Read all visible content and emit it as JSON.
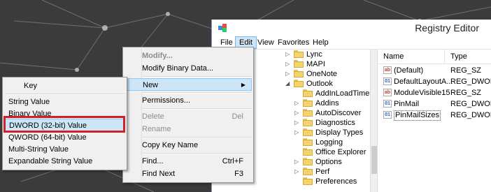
{
  "window": {
    "title": "Registry Editor",
    "menu": [
      "File",
      "Edit",
      "View",
      "Favorites",
      "Help"
    ],
    "active_menu": "Edit"
  },
  "tree": {
    "items": [
      {
        "label": "Lync",
        "expander": "▷"
      },
      {
        "label": "MAPI",
        "expander": "▷"
      },
      {
        "label": "OneNote",
        "expander": "▷"
      },
      {
        "label": "Outlook",
        "expander": "◢"
      },
      {
        "label": "AddInLoadTimes",
        "expander": ""
      },
      {
        "label": "Addins",
        "expander": "▷"
      },
      {
        "label": "AutoDiscover",
        "expander": "▷"
      },
      {
        "label": "Diagnostics",
        "expander": "▷"
      },
      {
        "label": "Display Types",
        "expander": "▷"
      },
      {
        "label": "Logging",
        "expander": ""
      },
      {
        "label": "Office Explorer",
        "expander": ""
      },
      {
        "label": "Options",
        "expander": "▷"
      },
      {
        "label": "Perf",
        "expander": "▷"
      },
      {
        "label": "Preferences",
        "expander": ""
      }
    ]
  },
  "values": {
    "columns": {
      "name": "Name",
      "type": "Type"
    },
    "rows": [
      {
        "icon": "ab",
        "name": "(Default)",
        "type": "REG_SZ"
      },
      {
        "icon": "bin",
        "name": "DefaultLayoutA...",
        "type": "REG_DWORD"
      },
      {
        "icon": "ab",
        "name": "ModuleVisible15",
        "type": "REG_SZ"
      },
      {
        "icon": "bin",
        "name": "PinMail",
        "type": "REG_DWORD"
      },
      {
        "icon": "bin",
        "name": "PinMailSizes",
        "type": "REG_DWORD"
      }
    ]
  },
  "context_menu": {
    "items": [
      {
        "label": "Modify...",
        "shortcut": "",
        "state": "disabled-bold"
      },
      {
        "label": "Modify Binary Data...",
        "shortcut": "",
        "state": "normal"
      },
      {
        "label": "New",
        "shortcut": "",
        "state": "highlight"
      },
      {
        "label": "Permissions...",
        "shortcut": "",
        "state": "normal"
      },
      {
        "label": "Delete",
        "shortcut": "Del",
        "state": "disabled"
      },
      {
        "label": "Rename",
        "shortcut": "",
        "state": "disabled"
      },
      {
        "label": "Copy Key Name",
        "shortcut": "",
        "state": "normal"
      },
      {
        "label": "Find...",
        "shortcut": "Ctrl+F",
        "state": "normal"
      },
      {
        "label": "Find Next",
        "shortcut": "F3",
        "state": "normal"
      }
    ]
  },
  "submenu": {
    "items": [
      {
        "label": "Key"
      },
      {
        "label": "String Value"
      },
      {
        "label": "Binary Value"
      },
      {
        "label": "DWORD (32-bit) Value"
      },
      {
        "label": "QWORD (64-bit) Value"
      },
      {
        "label": "Multi-String Value"
      },
      {
        "label": "Expandable String Value"
      }
    ],
    "selected": "DWORD (32-bit) Value"
  },
  "colors": {
    "highlight": "#cde6f7",
    "annotation_box": "#d0202a",
    "folder": "#f3d36b"
  }
}
